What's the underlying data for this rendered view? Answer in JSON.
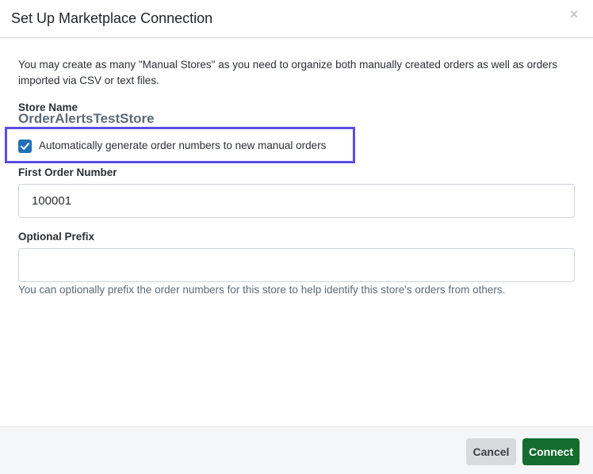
{
  "dialog": {
    "title": "Set Up Marketplace Connection",
    "close_glyph": "×"
  },
  "intro_text": "You may create as many \"Manual Stores\" as you need to organize both manually created orders as well as orders imported via CSV or text files.",
  "store": {
    "label": "Store Name",
    "value": "OrderAlertsTestStore"
  },
  "auto_generate": {
    "label": "Automatically generate order numbers to new manual orders",
    "checked": true
  },
  "first_order_number": {
    "label": "First Order Number",
    "value": "100001"
  },
  "optional_prefix": {
    "label": "Optional Prefix",
    "value": "",
    "help": "You can optionally prefix the order numbers for this store to help identify this store's orders from others."
  },
  "footer": {
    "cancel_label": "Cancel",
    "connect_label": "Connect"
  },
  "colors": {
    "highlight": "#5a4de6",
    "checkbox": "#1f6fb8",
    "connect_button": "#146c2e",
    "cancel_button": "#d8dbde"
  },
  "icons": {
    "close": "close-icon",
    "check": "checkmark-icon"
  }
}
